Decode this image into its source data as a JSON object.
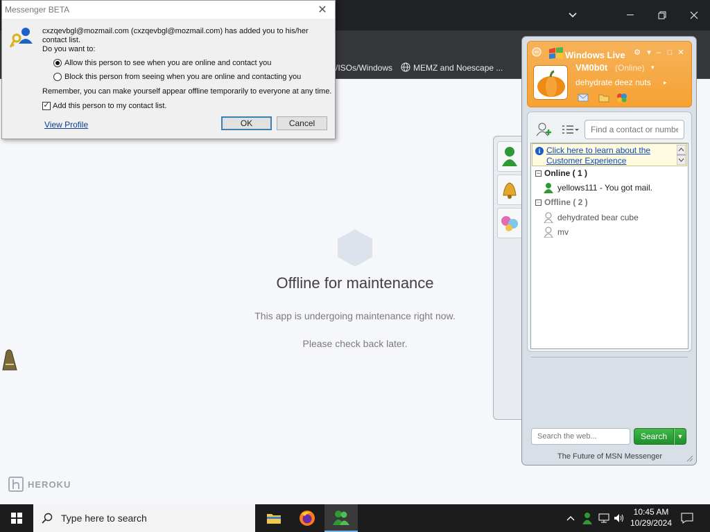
{
  "browser": {
    "bookmarks": [
      "/ISOs/Windows",
      "MEMZ and Noescape ..."
    ]
  },
  "page": {
    "title": "Offline for maintenance",
    "line1": "This app is undergoing maintenance right now.",
    "line2": "Please check back later.",
    "logo": "HEROKU"
  },
  "dialog": {
    "title": "Messenger BETA",
    "message": "cxzqevbgl@mozmail.com (cxzqevbgl@mozmail.com) has added you to his/her contact list.",
    "question": "Do you want to:",
    "option_allow": "Allow this person to see when you are online and contact you",
    "option_block": "Block this person from seeing when you are online and contacting you",
    "remember": "Remember, you can make yourself appear offline temporarily to everyone at any time.",
    "add_contact_label": "Add this person to my contact list.",
    "add_contact_checked": true,
    "view_profile": "View Profile",
    "ok": "OK",
    "cancel": "Cancel"
  },
  "messenger": {
    "brand": "Windows Live",
    "username": "VM0b0t",
    "status": "(Online)",
    "personal_message": "dehydrate deez nuts",
    "find_placeholder": "Find a contact or number",
    "cx_banner": "Click here to learn about the Customer Experience",
    "groups": [
      {
        "label": "Online ( 1 )",
        "contacts": [
          "yellows111 - You got mail."
        ]
      },
      {
        "label": "Offline ( 2 )",
        "contacts": [
          "dehydrated bear cube",
          "mv"
        ]
      }
    ],
    "web_search_placeholder": "Search the web...",
    "search_button": "Search",
    "footer": "The Future of MSN Messenger"
  },
  "taskbar": {
    "search_placeholder": "Type here to search",
    "time": "10:45 AM",
    "date": "10/29/2024"
  }
}
